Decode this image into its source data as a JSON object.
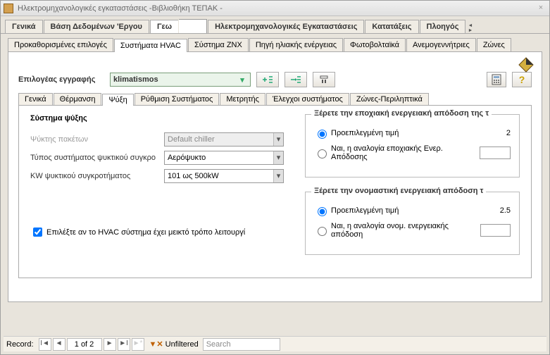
{
  "title": "Ηλεκτρομηχανολογικές εγκαταστάσεις -Βιβλιοθήκη ΤΕΠΑΚ -",
  "mainTabs": {
    "general": "Γενικά",
    "projectDb": "Βάση Δεδομένων 'Εργου",
    "geo": "Γεω",
    "mep": "Ηλεκτρομηχανολογικές Εγκαταστάσεις",
    "rankings": "Κατατάξεις",
    "wizard": "Πλοηγός"
  },
  "subTabs": {
    "presets": "Προκαθορισμένες επιλογές",
    "hvac": "Συστήματα HVAC",
    "znx": "Σύστημα ΖΝΧ",
    "solar": "Πηγή ηλιακής ενέργειας",
    "pv": "Φωτοβολταϊκά",
    "wind": "Ανεμογεννήτριες",
    "zones": "Ζώνες"
  },
  "selector": {
    "label": "Επιλογέας εγγραφής",
    "value": "klimatismos"
  },
  "innerTabs": {
    "general": "Γενικά",
    "heating": "Θέρμανση",
    "cooling": "Ψύξη",
    "systemReg": "Ρύθμιση Συστήματος",
    "meter": "Μετρητής",
    "sysChecks": "Έλεγχοι συστήματος",
    "zonesSummary": "Ζώνες-Περιληπτικά"
  },
  "cooling": {
    "sectionTitle": "Σύστημα ψύξης",
    "packChillerLabel": "Ψύκτης πακέτων",
    "packChillerValue": "Default chiller",
    "chillerTypeLabel": "Τύπος συστήματος ψυκτικού συγκρο",
    "chillerTypeValue": "Αερόψυκτο",
    "kwLabel": "KW ψυκτικού συγκροτήματος",
    "kwValue": "101 ως 500kW",
    "mixedModeLabel": "Επιλέξτε αν το HVAC σύστημα έχει μεικτό τρόπο λειτουργί"
  },
  "seasonal": {
    "title": "Ξέρετε την εποχιακή ενεργειακή απόδοση της τ",
    "optDefault": "Προεπιλεγμένη τιμή",
    "optRatio": "Ναι, η αναλογία εποχιακής  Ενερ. Απόδοσης",
    "defaultVal": "2"
  },
  "nominal": {
    "title": "Ξέρετε την ονομαστική ενεργειακή απόδοση τ",
    "optDefault": "Προεπιλεγμένη τιμή",
    "optRatio": "Ναι, η  αναλογία ονομ. ενεργειακής απόδοση",
    "defaultVal": "2.5"
  },
  "recordNav": {
    "label": "Record:",
    "pos": "1 of 2",
    "filter": "Unfiltered",
    "search": "Search"
  }
}
